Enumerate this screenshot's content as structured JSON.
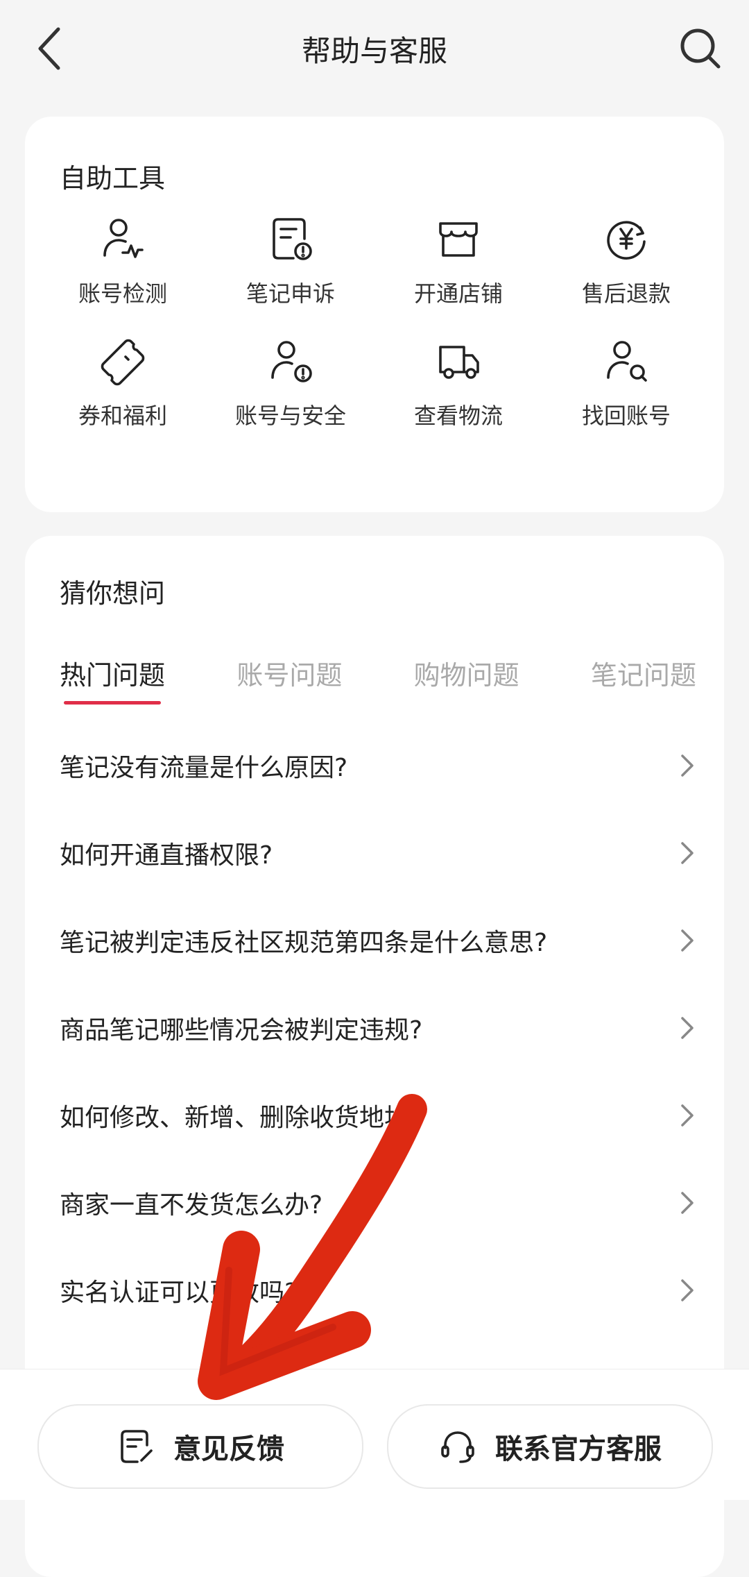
{
  "header": {
    "title": "帮助与客服"
  },
  "tools": {
    "title": "自助工具",
    "items": [
      {
        "label": "账号检测",
        "icon": "account-check-icon"
      },
      {
        "label": "笔记申诉",
        "icon": "note-appeal-icon"
      },
      {
        "label": "开通店铺",
        "icon": "store-icon"
      },
      {
        "label": "售后退款",
        "icon": "refund-icon"
      },
      {
        "label": "券和福利",
        "icon": "coupon-icon"
      },
      {
        "label": "账号与安全",
        "icon": "account-security-icon"
      },
      {
        "label": "查看物流",
        "icon": "truck-icon"
      },
      {
        "label": "找回账号",
        "icon": "account-search-icon"
      }
    ]
  },
  "faq": {
    "title": "猜你想问",
    "tabs": [
      "热门问题",
      "账号问题",
      "购物问题",
      "笔记问题"
    ],
    "active_tab": "热门问题",
    "questions": [
      "笔记没有流量是什么原因?",
      "如何开通直播权限?",
      "笔记被判定违反社区规范第四条是什么意思?",
      "商品笔记哪些情况会被判定违规?",
      "如何修改、新增、删除收货地址?",
      "商家一直不发货怎么办?",
      "实名认证可以更改吗?"
    ]
  },
  "bottom": {
    "feedback_label": "意见反馈",
    "service_label": "联系官方客服"
  },
  "colors": {
    "accent": "#e02e48",
    "annotation_arrow": "#dd2a12",
    "background": "#f5f5f5"
  }
}
